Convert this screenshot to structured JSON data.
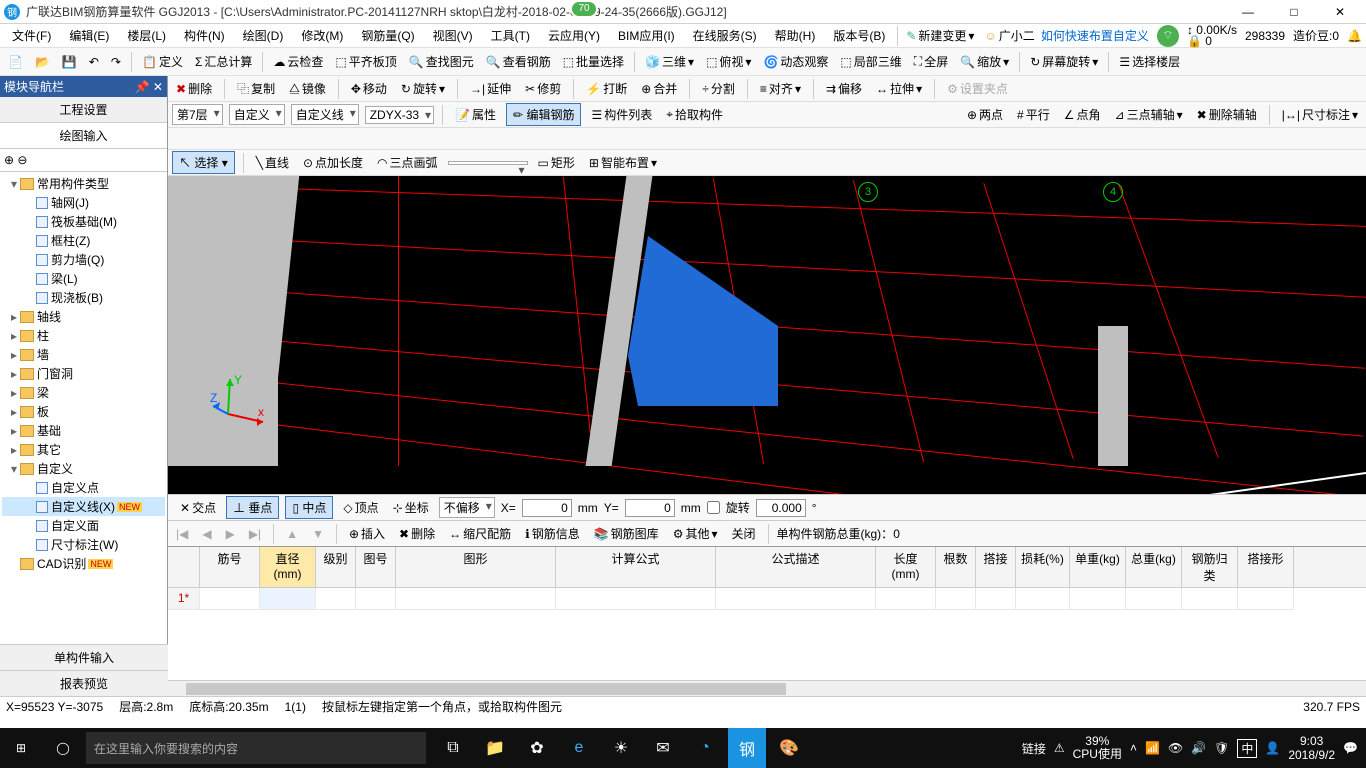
{
  "title": "广联达BIM钢筋算量软件 GGJ2013 - [C:\\Users\\Administrator.PC-20141127NRH        sktop\\白龙村-2018-02-02-19-24-35(2666版).GGJ12]",
  "badge": "70",
  "win": {
    "min": "—",
    "max": "□",
    "close": "✕"
  },
  "menus": [
    "文件(F)",
    "编辑(E)",
    "楼层(L)",
    "构件(N)",
    "绘图(D)",
    "修改(M)",
    "钢筋量(Q)",
    "视图(V)",
    "工具(T)",
    "云应用(Y)",
    "BIM应用(I)",
    "在线服务(S)",
    "帮助(H)",
    "版本号(B)"
  ],
  "menu_right": {
    "new_change": "新建变更",
    "user": "广小二",
    "quick": "如何快速布置自定义",
    "speed": "0.00K/s",
    "num": "298339",
    "price": "造价豆:0",
    "lock": "0"
  },
  "tb1": {
    "define": "定义",
    "sumcalc": "汇总计算",
    "cloudcheck": "云检查",
    "flatroof": "平齐板顶",
    "findgraph": "查找图元",
    "viewrebar": "查看钢筋",
    "batchsel": "批量选择",
    "threed": "三维",
    "overlook": "俯视",
    "dynview": "动态观察",
    "local3d": "局部三维",
    "fullscreen": "全屏",
    "zoom": "缩放",
    "screenrot": "屏幕旋转",
    "selfloor": "选择楼层"
  },
  "tb2": {
    "delete": "删除",
    "copy": "复制",
    "mirror": "镜像",
    "move": "移动",
    "rotate": "旋转",
    "extend": "延伸",
    "trim": "修剪",
    "break": "打断",
    "merge": "合并",
    "split": "分割",
    "align": "对齐",
    "offset": "偏移",
    "stretch": "拉伸",
    "setclamp": "设置夹点"
  },
  "tb3": {
    "floor": "第7层",
    "custom": "自定义",
    "customline": "自定义线",
    "code": "ZDYX-33",
    "attr": "属性",
    "editrebar": "编辑钢筋",
    "complist": "构件列表",
    "pickcomp": "拾取构件",
    "twopoint": "两点",
    "parallel": "平行",
    "pointangle": "点角",
    "threeaux": "三点辅轴",
    "delaux": "删除辅轴",
    "dimmark": "尺寸标注"
  },
  "tb4": {
    "select": "选择",
    "line": "直线",
    "addlen": "点加长度",
    "arc3": "三点画弧",
    "rect": "矩形",
    "smartlay": "智能布置"
  },
  "sidebar": {
    "header": "模块导航栏",
    "tabs": {
      "setting": "工程设置",
      "draw": "绘图输入"
    }
  },
  "tree": [
    {
      "l": 0,
      "exp": "▾",
      "ico": "folder",
      "txt": "常用构件类型"
    },
    {
      "l": 1,
      "ico": "leaf",
      "txt": "轴网(J)"
    },
    {
      "l": 1,
      "ico": "leaf",
      "txt": "筏板基础(M)"
    },
    {
      "l": 1,
      "ico": "leaf",
      "txt": "框柱(Z)"
    },
    {
      "l": 1,
      "ico": "leaf",
      "txt": "剪力墙(Q)"
    },
    {
      "l": 1,
      "ico": "leaf",
      "txt": "梁(L)"
    },
    {
      "l": 1,
      "ico": "leaf",
      "txt": "现浇板(B)"
    },
    {
      "l": 0,
      "exp": "▸",
      "ico": "folder",
      "txt": "轴线"
    },
    {
      "l": 0,
      "exp": "▸",
      "ico": "folder",
      "txt": "柱"
    },
    {
      "l": 0,
      "exp": "▸",
      "ico": "folder",
      "txt": "墙"
    },
    {
      "l": 0,
      "exp": "▸",
      "ico": "folder",
      "txt": "门窗洞"
    },
    {
      "l": 0,
      "exp": "▸",
      "ico": "folder",
      "txt": "梁"
    },
    {
      "l": 0,
      "exp": "▸",
      "ico": "folder",
      "txt": "板"
    },
    {
      "l": 0,
      "exp": "▸",
      "ico": "folder",
      "txt": "基础"
    },
    {
      "l": 0,
      "exp": "▸",
      "ico": "folder",
      "txt": "其它"
    },
    {
      "l": 0,
      "exp": "▾",
      "ico": "folder",
      "txt": "自定义"
    },
    {
      "l": 1,
      "ico": "leaf",
      "txt": "自定义点"
    },
    {
      "l": 1,
      "ico": "leaf",
      "txt": "自定义线(X)",
      "sel": true,
      "new": true
    },
    {
      "l": 1,
      "ico": "leaf",
      "txt": "自定义面"
    },
    {
      "l": 1,
      "ico": "leaf",
      "txt": "尺寸标注(W)"
    },
    {
      "l": 0,
      "ico": "folder",
      "txt": "CAD识别",
      "new": true
    }
  ],
  "bottomtabs": {
    "single": "单构件输入",
    "preview": "报表预览"
  },
  "grid_labels": {
    "g3": "3",
    "g4": "4"
  },
  "coord": {
    "cross": "交点",
    "perp": "垂点",
    "mid": "中点",
    "vertex": "顶点",
    "coord": "坐标",
    "nooffset": "不偏移",
    "x": "X=",
    "xval": "0",
    "mm": "mm",
    "y": "Y=",
    "yval": "0",
    "rot": "旋转",
    "rotval": "0.000",
    "deg": "°"
  },
  "lower": {
    "insert": "插入",
    "delete": "删除",
    "scaledist": "缩尺配筋",
    "rebarinfo": "钢筋信息",
    "rebarlib": "钢筋图库",
    "other": "其他",
    "close": "关闭",
    "total": "单构件钢筋总重(kg)：",
    "totalval": "0"
  },
  "table": {
    "cols": [
      "筋号",
      "直径(mm)",
      "级别",
      "图号",
      "图形",
      "计算公式",
      "公式描述",
      "长度(mm)",
      "根数",
      "搭接",
      "损耗(%)",
      "单重(kg)",
      "总重(kg)",
      "钢筋归类",
      "搭接形"
    ],
    "row1": "1*"
  },
  "status": {
    "xy": "X=95523 Y=-3075",
    "floorh": "层高:2.8m",
    "baseh": "底标高:20.35m",
    "count": "1(1)",
    "hint": "按鼠标左键指定第一个角点，或拾取构件图元",
    "fps": "320.7 FPS"
  },
  "taskbar": {
    "search": "在这里输入你要搜索的内容",
    "link": "链接",
    "cpu": "39%",
    "cpulabel": "CPU使用",
    "ime": "中",
    "time": "9:03",
    "date": "2018/9/2"
  }
}
